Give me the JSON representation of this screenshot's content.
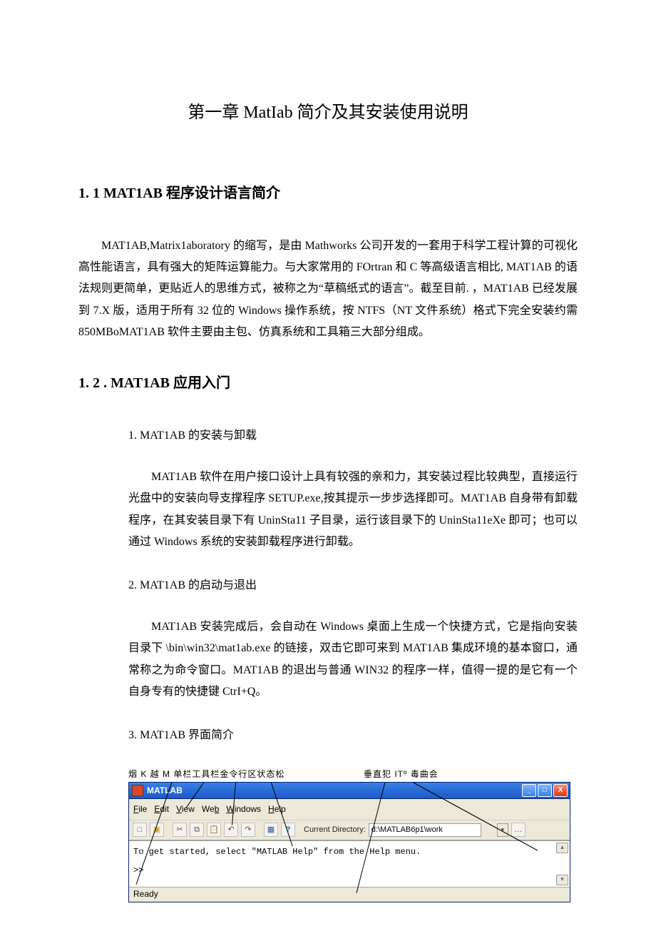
{
  "title": "第一章 MatIab 简介及其安装使用说明",
  "sections": {
    "s1": {
      "heading": "1. 1 MAT1AB 程序设计语言简介",
      "p1": "MAT1AB,Matrix1aboratory 的缩写，是由 Mathworks 公司开发的一套用于科学工程计算的可视化高性能语言，具有强大的矩阵运算能力。与大家常用的 FOrtran 和 C 等高级语言相比, MAT1AB 的语法规则更简单，更贴近人的思维方式，被称之为“草稿纸式的语言”。截至目前. ，MAT1AB 已经发展到 7.X 版，适用于所有 32 位的 Windows 操作系统，按 NTFS（NT 文件系统）格式下完全安装约需 850MBoMAT1AB 软件主要由主包、仿真系统和工具箱三大部分组成。"
    },
    "s2": {
      "heading": "1. 2 . MAT1AB 应用入门",
      "items": {
        "i1": {
          "h": "1.  MAT1AB 的安装与卸载",
          "p": "MAT1AB 软件在用户接口设计上具有较强的亲和力，其安装过程比较典型，直接运行光盘中的安装向导支撑程序 SETUP.exe,按其提示一步步选择即可。MAT1AB 自身带有卸载程序，在其安装目录下有 UninSta11 子目录，运行该目录下的 UninSta11eXe 即可；也可以通过 Windows 系统的安装卸载程序进行卸载。"
        },
        "i2": {
          "h": "2.  MAT1AB 的启动与退出",
          "p": "MAT1AB 安装完成后，会自动在 Windows 桌面上生成一个快捷方式，它是指向安装目录下 \\bin\\win32\\mat1ab.exe 的链接，双击它即可来到 MAT1AB 集成环境的基本窗口，通常称之为命令窗口。MAT1AB 的退出与普通 WIN32 的程序一样，值得一提的是它有一个自身专有的快捷键 CtrI+Q。"
        },
        "i3": {
          "h": "3.  MAT1AB 界面简介"
        }
      }
    }
  },
  "figure": {
    "labels": {
      "left": "烟 K 越    M 单栏工具栏金令行区状态松",
      "right": "垂直犯 ITº 毒曲会"
    },
    "window_title": "MATLAB",
    "menus": {
      "file": "File",
      "edit": "Edit",
      "view": "View",
      "web": "Web",
      "wins": "Windows",
      "help": "Help"
    },
    "toolbar": {
      "cur_dir_label": "Current Directory:",
      "cur_dir_value": "d:\\MATLAB6p1\\work"
    },
    "cmd": {
      "start_msg": "To get started, select \"MATLAB Help\" from the Help menu.",
      "prompt": ">>"
    },
    "status": "Ready"
  }
}
